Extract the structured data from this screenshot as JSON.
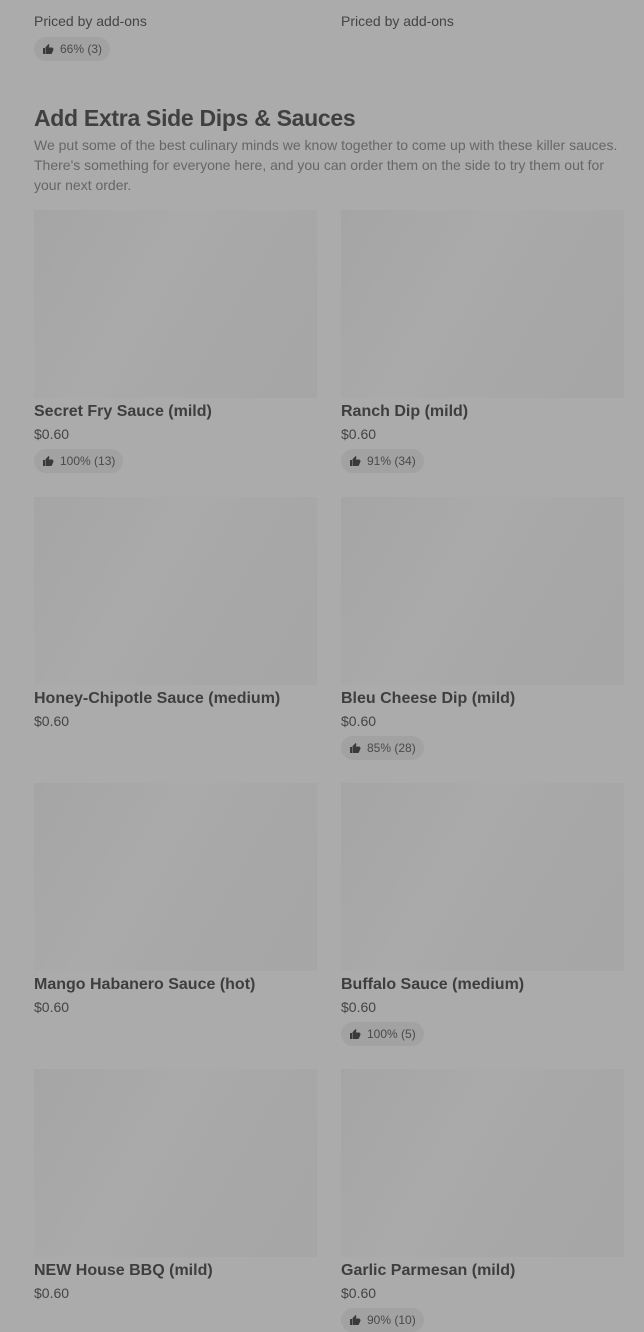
{
  "top_items": [
    {
      "price_note": "Priced by add-ons",
      "rating": "66% (3)"
    },
    {
      "price_note": "Priced by add-ons",
      "rating": null
    }
  ],
  "section": {
    "title": "Add Extra Side Dips & Sauces",
    "description": "We put some of the best culinary minds we know together to come up with these killer sauces. There's something for everyone here, and you can order them on the side to try them out for your next order."
  },
  "items": [
    {
      "name": "Secret Fry Sauce (mild)",
      "price": "$0.60",
      "rating": "100% (13)"
    },
    {
      "name": "Ranch Dip (mild)",
      "price": "$0.60",
      "rating": "91% (34)"
    },
    {
      "name": "Honey-Chipotle Sauce (medium)",
      "price": "$0.60",
      "rating": null
    },
    {
      "name": "Bleu Cheese Dip (mild)",
      "price": "$0.60",
      "rating": "85% (28)"
    },
    {
      "name": "Mango Habanero Sauce (hot)",
      "price": "$0.60",
      "rating": null
    },
    {
      "name": "Buffalo Sauce (medium)",
      "price": "$0.60",
      "rating": "100% (5)"
    },
    {
      "name": "NEW House BBQ (mild)",
      "price": "$0.60",
      "rating": null
    },
    {
      "name": "Garlic Parmesan (mild)",
      "price": "$0.60",
      "rating": "90% (10)"
    }
  ],
  "icons": {
    "rating": "thumbs-up-icon"
  }
}
